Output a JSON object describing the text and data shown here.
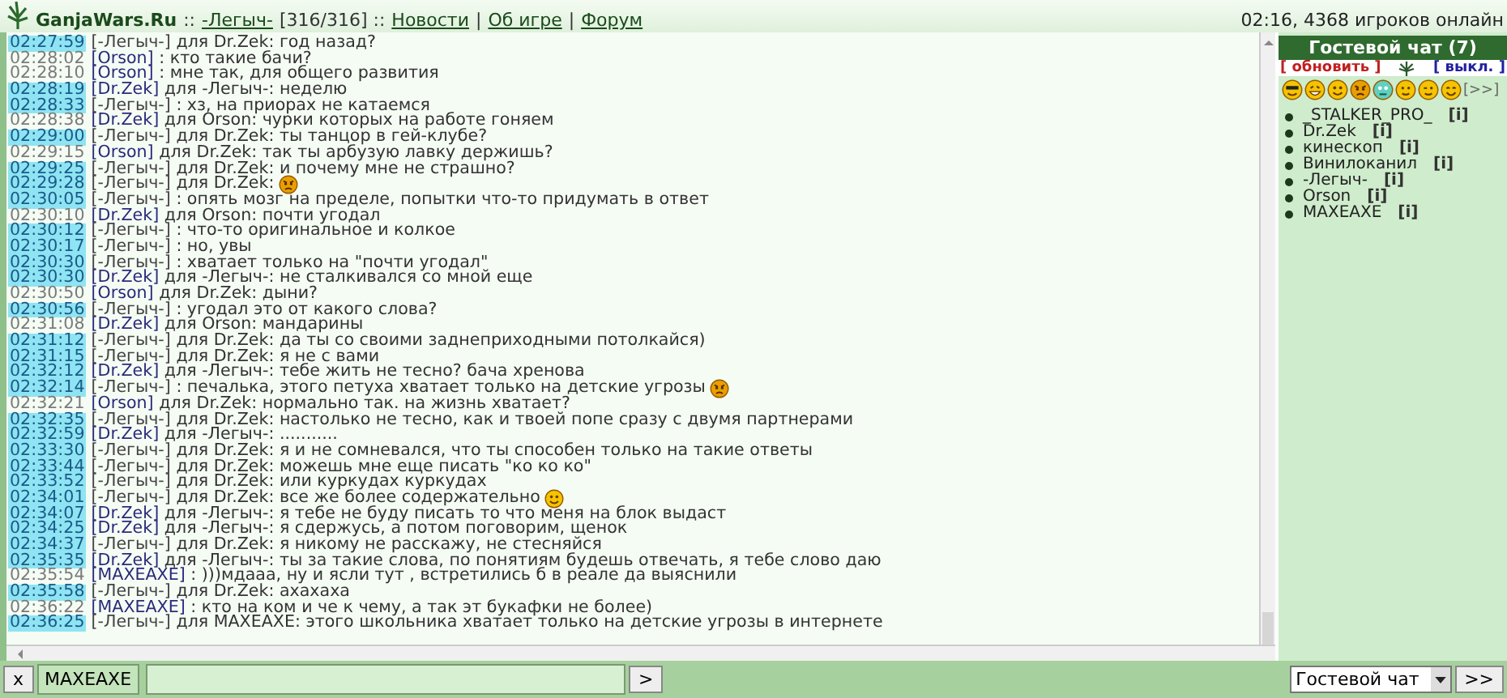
{
  "header": {
    "items": [
      {
        "kind": "site",
        "text": "GanjaWars.Ru"
      },
      {
        "kind": "plain",
        "text": "::"
      },
      {
        "kind": "link",
        "text": "-Легыч-"
      },
      {
        "kind": "plain",
        "text": "[316/316] ::"
      },
      {
        "kind": "link",
        "text": "Новости"
      },
      {
        "kind": "plain",
        "text": "|"
      },
      {
        "kind": "link",
        "text": "Об игре"
      },
      {
        "kind": "plain",
        "text": "|"
      },
      {
        "kind": "link",
        "text": "Форум"
      }
    ],
    "status": "02:16, 4368 игроков онлайн"
  },
  "chat": {
    "messages": [
      {
        "time": "02:27:59",
        "highlighted": true,
        "sender": "[-Легыч-]",
        "self": true,
        "text": "для Dr.Zek: год назад?"
      },
      {
        "time": "02:28:02",
        "highlighted": false,
        "sender": "[Orson]",
        "self": false,
        "text": ": кто такие бачи?"
      },
      {
        "time": "02:28:10",
        "highlighted": false,
        "sender": "[Orson]",
        "self": false,
        "text": ": мне так, для общего развития"
      },
      {
        "time": "02:28:19",
        "highlighted": true,
        "sender": "[Dr.Zek]",
        "self": false,
        "text": "для -Легыч-: неделю"
      },
      {
        "time": "02:28:33",
        "highlighted": true,
        "sender": "[-Легыч-]",
        "self": true,
        "text": ": хз, на приорах не катаемся"
      },
      {
        "time": "02:28:38",
        "highlighted": false,
        "sender": "[Dr.Zek]",
        "self": false,
        "text": "для Orson: чурки которых на работе гоняем"
      },
      {
        "time": "02:29:00",
        "highlighted": true,
        "sender": "[-Легыч-]",
        "self": true,
        "text": "для Dr.Zek: ты танцор в гей-клубе?"
      },
      {
        "time": "02:29:15",
        "highlighted": false,
        "sender": "[Orson]",
        "self": false,
        "text": "для Dr.Zek: так ты арбузую лавку держишь?"
      },
      {
        "time": "02:29:25",
        "highlighted": true,
        "sender": "[-Легыч-]",
        "self": true,
        "text": "для Dr.Zek: и почему мне не страшно?"
      },
      {
        "time": "02:29:28",
        "highlighted": true,
        "sender": "[-Легыч-]",
        "self": true,
        "text": "для Dr.Zek:",
        "smiley": {
          "kind": "angry"
        }
      },
      {
        "time": "02:30:05",
        "highlighted": true,
        "sender": "[-Легыч-]",
        "self": true,
        "text": ": опять мозг на пределе, попытки что-то придумать в ответ"
      },
      {
        "time": "02:30:10",
        "highlighted": false,
        "sender": "[Dr.Zek]",
        "self": false,
        "text": "для Orson: почти угодал"
      },
      {
        "time": "02:30:12",
        "highlighted": true,
        "sender": "[-Легыч-]",
        "self": true,
        "text": ": что-то оригинальное и колкое"
      },
      {
        "time": "02:30:17",
        "highlighted": true,
        "sender": "[-Легыч-]",
        "self": true,
        "text": ": но, увы"
      },
      {
        "time": "02:30:30",
        "highlighted": true,
        "sender": "[-Легыч-]",
        "self": true,
        "text": ": хватает только на \"почти угодал\""
      },
      {
        "time": "02:30:30",
        "highlighted": true,
        "sender": "[Dr.Zek]",
        "self": false,
        "text": "для -Легыч-: не сталкивался со мной еще"
      },
      {
        "time": "02:30:50",
        "highlighted": false,
        "sender": "[Orson]",
        "self": false,
        "text": "для Dr.Zek: дыни?"
      },
      {
        "time": "02:30:56",
        "highlighted": true,
        "sender": "[-Легыч-]",
        "self": true,
        "text": ": угодал это от какого слова?"
      },
      {
        "time": "02:31:08",
        "highlighted": false,
        "sender": "[Dr.Zek]",
        "self": false,
        "text": "для Orson: мандарины"
      },
      {
        "time": "02:31:12",
        "highlighted": true,
        "sender": "[-Легыч-]",
        "self": true,
        "text": "для Dr.Zek: да ты со своими заднеприходными потолкайся)"
      },
      {
        "time": "02:31:15",
        "highlighted": true,
        "sender": "[-Легыч-]",
        "self": true,
        "text": "для Dr.Zek: я не с вами"
      },
      {
        "time": "02:32:12",
        "highlighted": true,
        "sender": "[Dr.Zek]",
        "self": false,
        "text": "для -Легыч-: тебе жить не тесно? бача хренова"
      },
      {
        "time": "02:32:14",
        "highlighted": true,
        "sender": "[-Легыч-]",
        "self": true,
        "text": ": печалька, этого петуха хватает только на детские угрозы",
        "smiley": {
          "kind": "angry"
        }
      },
      {
        "time": "02:32:21",
        "highlighted": false,
        "sender": "[Orson]",
        "self": false,
        "text": "для Dr.Zek: нормально так. на жизнь хватает?"
      },
      {
        "time": "02:32:35",
        "highlighted": true,
        "sender": "[-Легыч-]",
        "self": true,
        "text": "для Dr.Zek: настолько не тесно, как и твоей попе сразу с двумя партнерами"
      },
      {
        "time": "02:32:59",
        "highlighted": true,
        "sender": "[Dr.Zek]",
        "self": false,
        "text": "для -Легыч-: ..........."
      },
      {
        "time": "02:33:30",
        "highlighted": true,
        "sender": "[-Легыч-]",
        "self": true,
        "text": "для Dr.Zek: я и не сомневался, что ты способен только на такие ответы"
      },
      {
        "time": "02:33:44",
        "highlighted": true,
        "sender": "[-Легыч-]",
        "self": true,
        "text": "для Dr.Zek: можешь мне еще писать \"ко ко ко\""
      },
      {
        "time": "02:33:52",
        "highlighted": true,
        "sender": "[-Легыч-]",
        "self": true,
        "text": "для Dr.Zek: или куркудах куркудах"
      },
      {
        "time": "02:34:01",
        "highlighted": true,
        "sender": "[-Легыч-]",
        "self": true,
        "text": "для Dr.Zek: все же более содержательно",
        "smiley": {
          "kind": "grin"
        }
      },
      {
        "time": "02:34:07",
        "highlighted": true,
        "sender": "[Dr.Zek]",
        "self": false,
        "text": "для -Легыч-: я тебе не буду писать то что меня на блок выдаст"
      },
      {
        "time": "02:34:25",
        "highlighted": true,
        "sender": "[Dr.Zek]",
        "self": false,
        "text": "для -Легыч-: я сдержусь, а потом поговорим, щенок"
      },
      {
        "time": "02:34:37",
        "highlighted": true,
        "sender": "[-Легыч-]",
        "self": true,
        "text": "для Dr.Zek: я никому не расскажу, не стесняйся"
      },
      {
        "time": "02:35:35",
        "highlighted": true,
        "sender": "[Dr.Zek]",
        "self": false,
        "text": "для -Легыч-: ты за такие слова, по понятиям будешь отвечать, я тебе слово даю"
      },
      {
        "time": "02:35:54",
        "highlighted": false,
        "sender": "[MAXEAXE]",
        "self": false,
        "text": ": )))мдааа, ну и ясли тут , встретились б в реале да выяснили"
      },
      {
        "time": "02:35:58",
        "highlighted": true,
        "sender": "[-Легыч-]",
        "self": true,
        "text": "для Dr.Zek: ахахаха"
      },
      {
        "time": "02:36:22",
        "highlighted": false,
        "sender": "[MAXEAXE]",
        "self": false,
        "text": ": кто на ком и че к чему, а так эт букафки не более)"
      },
      {
        "time": "02:36:25",
        "highlighted": true,
        "sender": "[-Легыч-]",
        "self": true,
        "text": "для MAXEAXE: этого школьника хватает только на детские угрозы в интернете"
      }
    ]
  },
  "panel": {
    "title": "Гостевой чат (7)",
    "refresh": "[ обновить ]",
    "off": "[ выкл. ]",
    "smileys": [
      {
        "kind": "cool"
      },
      {
        "kind": "laugh"
      },
      {
        "kind": "grin"
      },
      {
        "kind": "angry"
      },
      {
        "kind": "ghost"
      },
      {
        "kind": "smile"
      },
      {
        "kind": "wink"
      },
      {
        "kind": "happy"
      }
    ],
    "more": "[>>]",
    "users": [
      {
        "name": "_STALKER_PRO_",
        "info": "[i]"
      },
      {
        "name": "Dr.Zek",
        "info": "[i]"
      },
      {
        "name": "кинескоп",
        "info": "[i]"
      },
      {
        "name": "Винилоканил",
        "info": "[i]"
      },
      {
        "name": "-Легыч-",
        "info": "[i]"
      },
      {
        "name": "Orson",
        "info": "[i]"
      },
      {
        "name": "MAXEAXE",
        "info": "[i]"
      }
    ]
  },
  "input_bar": {
    "clear": "x",
    "recipient": "MAXEAXE",
    "send": ">",
    "channel": "Гостевой чат",
    "go": ">>"
  }
}
